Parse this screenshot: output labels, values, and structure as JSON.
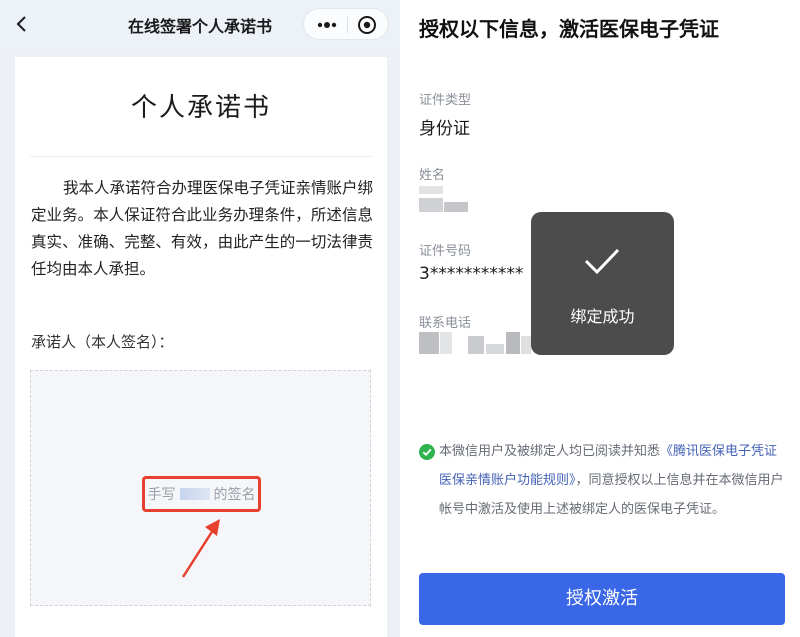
{
  "left": {
    "nav_title": "在线签署个人承诺书",
    "paper": {
      "title": "个人承诺书",
      "body": "我本人承诺符合办理医保电子凭证亲情账户绑定业务。本人保证符合此业务办理条件，所述信息真实、准确、完整、有效，由此产生的一切法律责任均由本人承担。",
      "sign_label": "承诺人（本人签名）：",
      "sign_hint_prefix": "手写",
      "sign_hint_suffix": "的签名"
    }
  },
  "right": {
    "title": "授权以下信息，激活医保电子凭证",
    "fields": {
      "id_type_label": "证件类型",
      "id_type_value": "身份证",
      "name_label": "姓名",
      "id_number_label": "证件号码",
      "id_number_value": "3***********",
      "phone_label": "联系电话"
    },
    "toast": {
      "text": "绑定成功"
    },
    "agreement": {
      "prefix": "本微信用户及被绑定人均已阅读并知悉",
      "link": "《腾讯医保电子凭证医保亲情账户功能规则》",
      "suffix": "，同意授权以上信息并在本微信用户帐号中激活及使用上述被绑定人的医保电子凭证。"
    },
    "activate_button": "授权激活"
  },
  "colors": {
    "primary_blue": "#3a66e8",
    "link_blue": "#4462b6",
    "success_green": "#2fb34e",
    "highlight_red": "#e8402f",
    "toast_bg": "#4c4c4c"
  },
  "icons": [
    "back-icon",
    "more-icon",
    "close-icon",
    "check-icon",
    "check-circle-icon",
    "arrow-icon"
  ]
}
